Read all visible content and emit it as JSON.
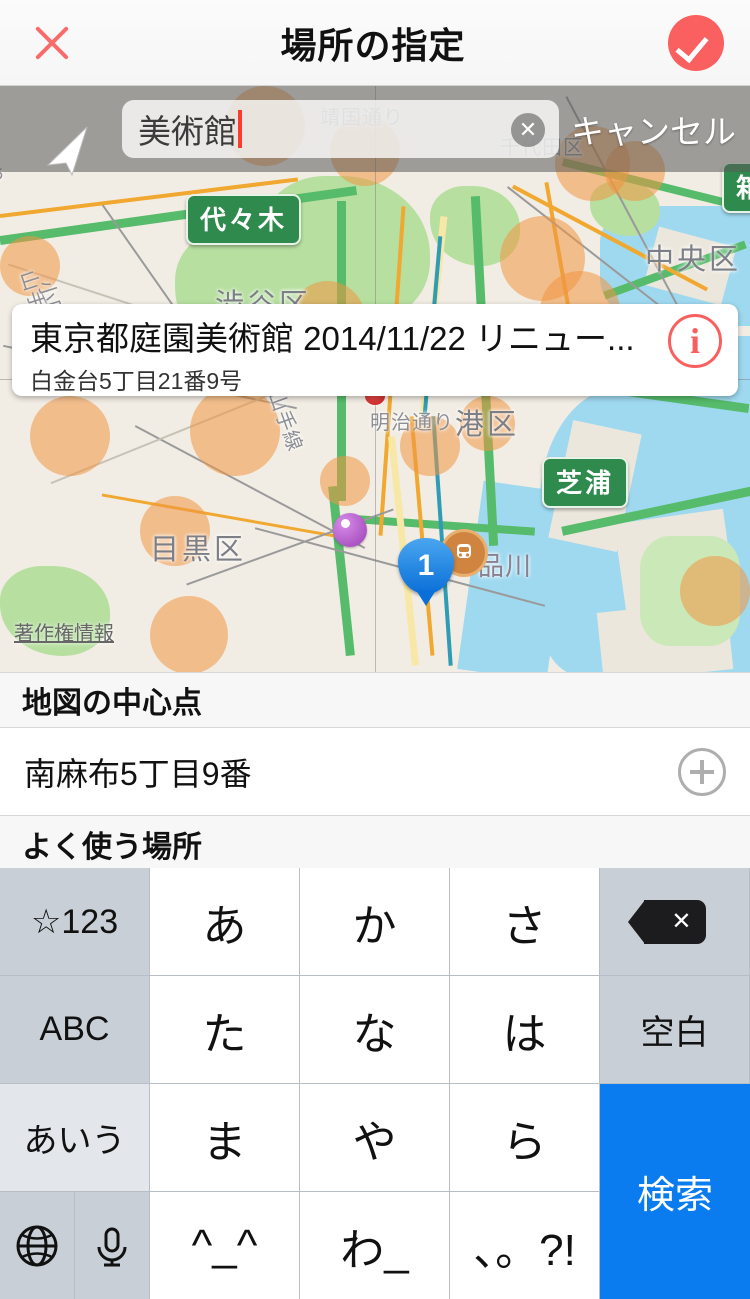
{
  "header": {
    "title": "場所の指定",
    "close_icon": "close-x-icon",
    "confirm_icon": "check-circle-icon"
  },
  "search": {
    "value": "美術館",
    "clear_icon": "clear-circle-icon",
    "cancel_label": "キャンセル",
    "location_icon": "location-arrow-icon"
  },
  "map": {
    "callout": {
      "title": "東京都庭園美術館 2014/11/22 リニュー...",
      "subtitle": "白金台5丁目21番9号",
      "info_icon": "info-circle-icon"
    },
    "copyright_label": "著作権情報",
    "center_marker": "map-center-crosshair",
    "pin_number": "1",
    "labels": [
      {
        "text": "代々木",
        "type": "station"
      },
      {
        "text": "芝浦",
        "type": "station"
      },
      {
        "text": "箱",
        "type": "station"
      },
      {
        "text": "渋谷区",
        "type": "ward"
      },
      {
        "text": "中央区",
        "type": "ward"
      },
      {
        "text": "港区",
        "type": "ward"
      },
      {
        "text": "目黒区",
        "type": "ward"
      },
      {
        "text": "品川",
        "type": "place"
      },
      {
        "text": "明治通り",
        "type": "road"
      },
      {
        "text": "靖国通り",
        "type": "road"
      },
      {
        "text": "千代田区",
        "type": "ward"
      },
      {
        "text": "山手線",
        "type": "rail"
      },
      {
        "text": "小田原線",
        "type": "rail"
      }
    ]
  },
  "sections": {
    "map_center": {
      "header": "地図の中心点",
      "value": "南麻布5丁目9番",
      "add_icon": "plus-circle-icon"
    },
    "frequent_places": {
      "header": "よく使う場所"
    }
  },
  "keyboard": {
    "rows": [
      [
        {
          "label": "☆123",
          "style": "gray",
          "name": "key-symbols"
        },
        {
          "label": "あ",
          "style": "white",
          "name": "key-a"
        },
        {
          "label": "か",
          "style": "white",
          "name": "key-ka"
        },
        {
          "label": "さ",
          "style": "white",
          "name": "key-sa"
        },
        {
          "label": "",
          "style": "gray",
          "name": "key-delete",
          "icon": "delete-icon"
        }
      ],
      [
        {
          "label": "ABC",
          "style": "gray",
          "name": "key-abc"
        },
        {
          "label": "た",
          "style": "white",
          "name": "key-ta"
        },
        {
          "label": "な",
          "style": "white",
          "name": "key-na"
        },
        {
          "label": "は",
          "style": "white",
          "name": "key-ha"
        },
        {
          "label": "空白",
          "style": "gray",
          "name": "key-space"
        }
      ],
      [
        {
          "label": "あいう",
          "style": "light",
          "name": "key-kana"
        },
        {
          "label": "ま",
          "style": "white",
          "name": "key-ma"
        },
        {
          "label": "や",
          "style": "white",
          "name": "key-ya"
        },
        {
          "label": "ら",
          "style": "white",
          "name": "key-ra"
        }
      ],
      [
        {
          "label": "",
          "style": "gray",
          "name": "key-globe",
          "icon": "globe-icon"
        },
        {
          "label": "",
          "style": "gray",
          "name": "key-mic",
          "icon": "mic-icon"
        },
        {
          "label": "^_^",
          "style": "white",
          "name": "key-emoticon"
        },
        {
          "label": "わ_",
          "style": "white",
          "name": "key-wa"
        },
        {
          "label": "、。?!",
          "style": "white",
          "name": "key-punct"
        }
      ]
    ],
    "search_key": "検索"
  },
  "colors": {
    "accent_red": "#fb6060",
    "keyboard_blue": "#0a7cf0",
    "station_green": "#2f8a4d"
  }
}
